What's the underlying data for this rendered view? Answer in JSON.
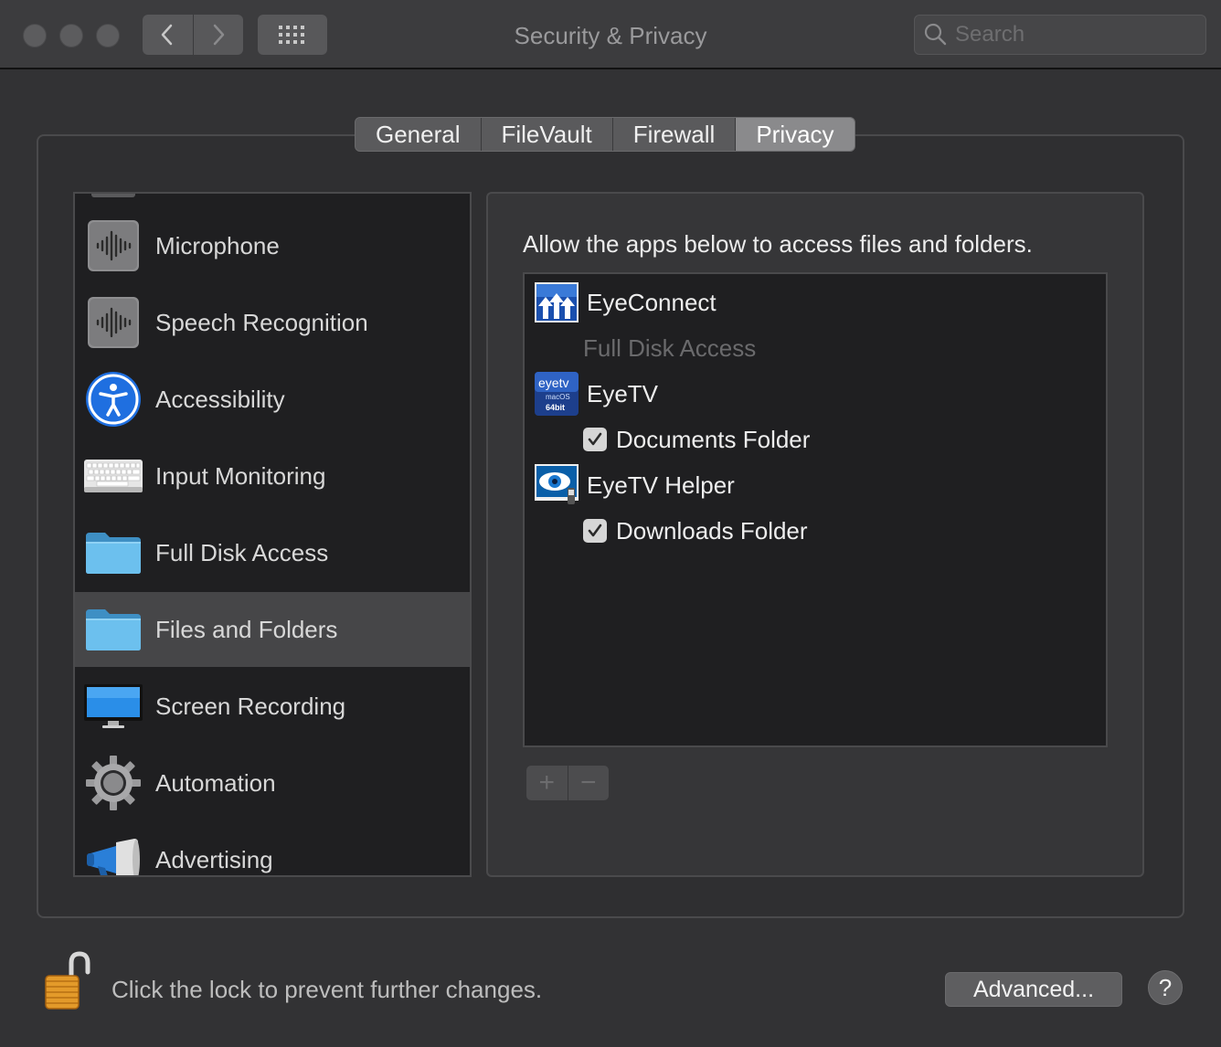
{
  "window": {
    "title": "Security & Privacy",
    "search_placeholder": "Search"
  },
  "tabs": [
    {
      "label": "General"
    },
    {
      "label": "FileVault"
    },
    {
      "label": "Firewall"
    },
    {
      "label": "Privacy",
      "active": true
    }
  ],
  "sidebar": {
    "items": [
      {
        "label": "Microphone",
        "icon": "waveform-icon"
      },
      {
        "label": "Speech Recognition",
        "icon": "waveform-icon"
      },
      {
        "label": "Accessibility",
        "icon": "accessibility-icon"
      },
      {
        "label": "Input Monitoring",
        "icon": "keyboard-icon"
      },
      {
        "label": "Full Disk Access",
        "icon": "folder-icon"
      },
      {
        "label": "Files and Folders",
        "icon": "folder-icon",
        "selected": true
      },
      {
        "label": "Screen Recording",
        "icon": "display-icon"
      },
      {
        "label": "Automation",
        "icon": "gear-icon"
      },
      {
        "label": "Advertising",
        "icon": "megaphone-icon"
      }
    ]
  },
  "panel": {
    "heading": "Allow the apps below to access files and folders.",
    "apps": [
      {
        "name": "EyeConnect",
        "icon": "eyeconnect-icon",
        "permissions": [
          {
            "label": "Full Disk Access",
            "checked": false,
            "disabled": true
          }
        ]
      },
      {
        "name": "EyeTV",
        "icon": "eyetv-icon",
        "permissions": [
          {
            "label": "Documents Folder",
            "checked": true
          }
        ]
      },
      {
        "name": "EyeTV Helper",
        "icon": "eyetv-helper-icon",
        "permissions": [
          {
            "label": "Downloads Folder",
            "checked": true
          }
        ]
      }
    ],
    "add_label": "+",
    "remove_label": "−"
  },
  "eyetv_icon_text": {
    "brand": "eyetv",
    "platform": "macOS",
    "bits": "64bit"
  },
  "footer": {
    "lock_text": "Click the lock to prevent further changes.",
    "advanced_label": "Advanced...",
    "help_label": "?"
  }
}
